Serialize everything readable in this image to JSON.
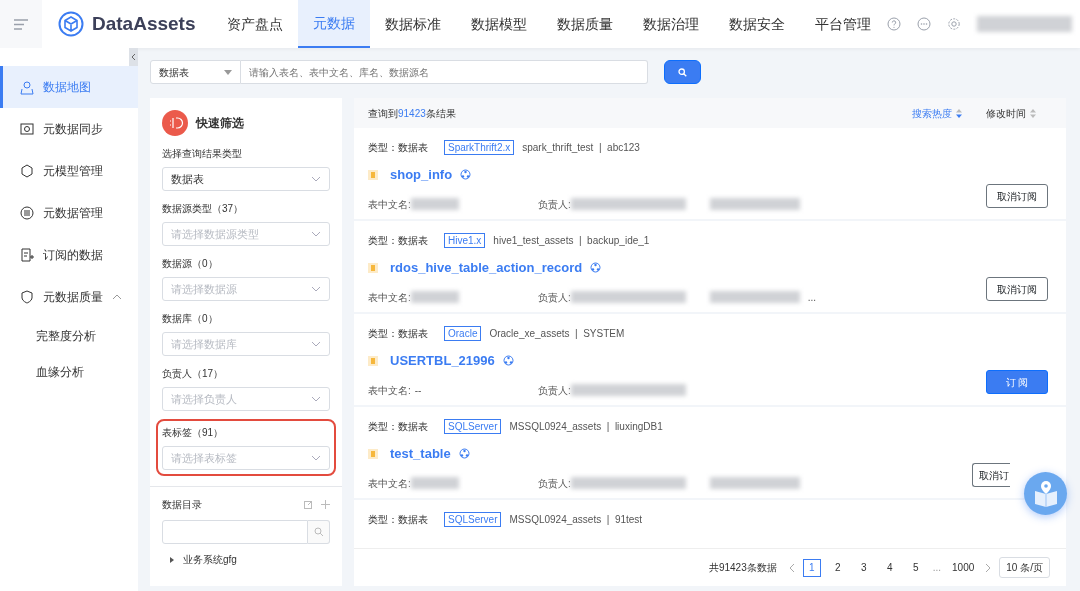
{
  "header": {
    "logo": "DataAssets",
    "tabs": [
      {
        "label": "资产盘点",
        "selected": false
      },
      {
        "label": "元数据",
        "selected": true
      },
      {
        "label": "数据标准",
        "selected": false
      },
      {
        "label": "数据模型",
        "selected": false
      },
      {
        "label": "数据质量",
        "selected": false
      },
      {
        "label": "数据治理",
        "selected": false
      },
      {
        "label": "数据安全",
        "selected": false
      },
      {
        "label": "平台管理",
        "selected": false
      }
    ]
  },
  "sidebar": {
    "items": [
      {
        "label": "数据地图",
        "selected": true
      },
      {
        "label": "元数据同步",
        "selected": false
      },
      {
        "label": "元模型管理",
        "selected": false
      },
      {
        "label": "元数据管理",
        "selected": false
      },
      {
        "label": "订阅的数据",
        "selected": false
      },
      {
        "label": "元数据质量",
        "selected": false,
        "expanded": true,
        "children": [
          {
            "label": "完整度分析",
            "selected": false
          },
          {
            "label": "血缘分析",
            "selected": false
          }
        ]
      }
    ]
  },
  "search": {
    "type": "数据表",
    "placeholder": "请输入表名、表中文名、库名、数据源名"
  },
  "filter": {
    "title": "快速筛选",
    "fields": [
      {
        "label": "选择查询结果类型",
        "value": "数据表",
        "highlighted": false
      },
      {
        "label": "数据源类型（37）",
        "placeholder": "请选择数据源类型",
        "highlighted": false
      },
      {
        "label": "数据源（0）",
        "placeholder": "请选择数据源",
        "highlighted": false
      },
      {
        "label": "数据库（0）",
        "placeholder": "请选择数据库",
        "highlighted": false
      },
      {
        "label": "负责人（17）",
        "placeholder": "请选择负责人",
        "highlighted": false
      },
      {
        "label": "表标签（91）",
        "placeholder": "请选择表标签",
        "highlighted": true
      }
    ],
    "catalog": {
      "title": "数据目录",
      "tree": [
        {
          "label": "业务系统gfg",
          "expanded": false
        }
      ]
    }
  },
  "results": {
    "summary_prefix": "查询到",
    "count": "91423",
    "summary_suffix": "条结果",
    "sort": [
      {
        "label": "搜索热度",
        "active": true
      },
      {
        "label": "修改时间",
        "active": false
      }
    ],
    "items": [
      {
        "type": "类型：数据表",
        "source": "SparkThrift2.x",
        "path": "spark_thrift_test  |  abc123",
        "name": "shop_info",
        "cn_label": "表中文名:",
        "owner_label": "负责人:",
        "subscribed": true,
        "action": "取消订阅"
      },
      {
        "type": "类型：数据表",
        "source": "Hive1.x",
        "path": "hive1_test_assets  |  backup_ide_1",
        "name": "rdos_hive_table_action_record",
        "cn_label": "表中文名:",
        "owner_label": "负责人:",
        "subscribed": true,
        "action": "取消订阅",
        "more": "..."
      },
      {
        "type": "类型：数据表",
        "source": "Oracle",
        "path": "Oracle_xe_assets  |  SYSTEM",
        "name": "USERTBL_21996",
        "cn_label": "表中文名:",
        "cn_name": "--",
        "owner_label": "负责人:",
        "subscribed": false,
        "action": "订 阅"
      },
      {
        "type": "类型：数据表",
        "source": "SQLServer",
        "path": "MSSQL0924_assets  |  liuxingDB1",
        "name": "test_table",
        "cn_label": "表中文名:",
        "owner_label": "负责人:",
        "subscribed": true,
        "action": "取消订",
        "partly_hidden": true
      },
      {
        "type": "类型：数据表",
        "source": "SQLServer",
        "path": "MSSQL0924_assets  |  91test"
      }
    ]
  },
  "pagination": {
    "total": "共91423条数据",
    "pages": [
      {
        "label": "1",
        "selected": true
      },
      {
        "label": "2",
        "selected": false
      },
      {
        "label": "3",
        "selected": false
      },
      {
        "label": "4",
        "selected": false
      },
      {
        "label": "5",
        "selected": false
      }
    ],
    "ellipsis": "...",
    "last": "1000",
    "size": "10 条/页"
  }
}
